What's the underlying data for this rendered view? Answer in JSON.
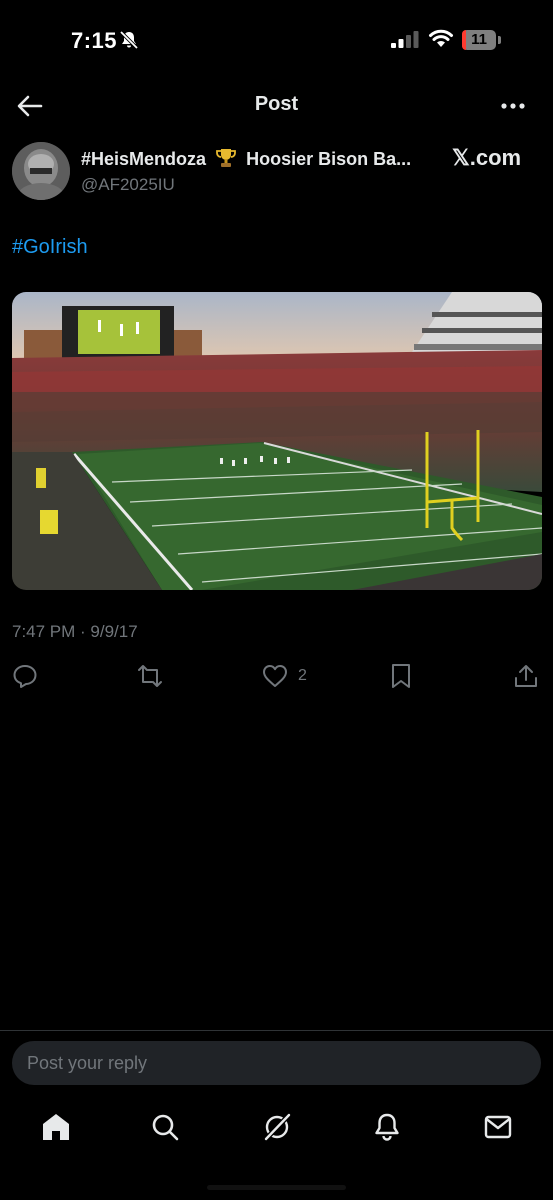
{
  "status_bar": {
    "time": "7:15",
    "battery_level": "11",
    "battery_fraction": 0.11,
    "icons": [
      "bell-slash-icon",
      "signal-icon",
      "wifi-icon",
      "battery-icon"
    ]
  },
  "header": {
    "title": "Post",
    "back_icon": "arrow-left-icon",
    "more_icon": "more-horizontal-icon"
  },
  "post": {
    "author": {
      "name_part1": "#HeisMendoza",
      "trophy_icon": "trophy-icon",
      "name_part2": "Hoosier Bison Ba...",
      "handle": "@AF2025IU",
      "source": "𝕏.com"
    },
    "text": "#GoIrish",
    "image_alt": "stadium-photo",
    "timestamp": "7:47 PM · 9/9/17",
    "actions": {
      "like_count": "2",
      "icons": [
        "reply-icon",
        "repost-icon",
        "heart-icon",
        "bookmark-icon",
        "share-icon"
      ]
    }
  },
  "reply": {
    "placeholder": "Post your reply"
  },
  "tab_bar": {
    "icons": [
      "home-icon",
      "search-icon",
      "grok-icon",
      "notifications-icon",
      "messages-icon"
    ]
  },
  "colors": {
    "background": "#000000",
    "text": "#e7e9ea",
    "secondary": "#71767b",
    "accent": "#1d9bf0",
    "reply_box": "#202327"
  }
}
